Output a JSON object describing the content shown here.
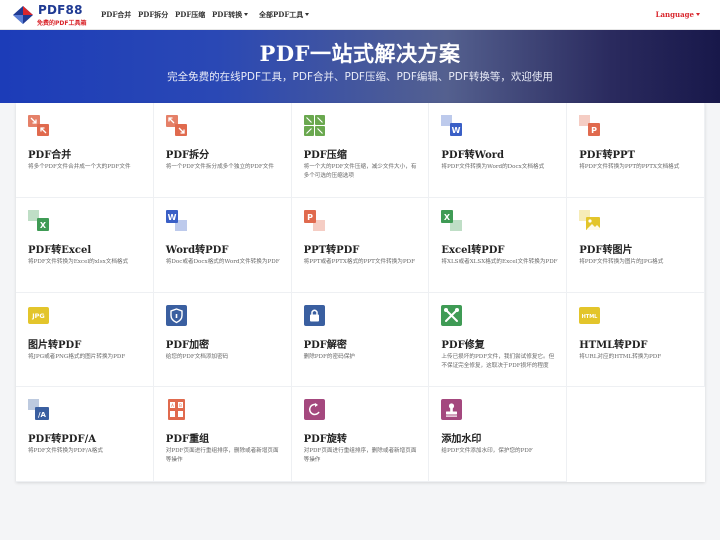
{
  "nav": {
    "logo_name": "PDF88",
    "logo_slogan": "免费的PDF工具箱",
    "items": [
      "PDF合并",
      "PDF拆分",
      "PDF压缩",
      "PDF转换",
      "全部PDF工具"
    ],
    "language": "Language"
  },
  "hero": {
    "title": "PDF一站式解决方案",
    "subtitle": "完全免费的在线PDF工具，PDF合并、PDF压缩、PDF编辑、PDF转换等，欢迎使用"
  },
  "colors": {
    "brand": "#1f3a93",
    "accent_red": "#d9262c"
  },
  "tools": [
    {
      "title": "PDF合并",
      "desc": "将多个PDF文件合并成一个大的PDF文件",
      "icon": "merge-icon",
      "color": "#e06a4e",
      "icon_style": "pair-arrows-in"
    },
    {
      "title": "PDF拆分",
      "desc": "将一个PDF文件拆分成多个独立的PDF文件",
      "icon": "split-icon",
      "color": "#e06a4e",
      "icon_style": "pair-arrows-out"
    },
    {
      "title": "PDF压缩",
      "desc": "将一个大的PDF文件压缩，减少文件大小，有多个可选的压缩选项",
      "icon": "compress-icon",
      "color": "#6aa84f",
      "icon_style": "compress"
    },
    {
      "title": "PDF转Word",
      "desc": "将PDF文件转换为Word的Docx文档格式",
      "icon": "pdf-to-word-icon",
      "color": "#3a5fc6",
      "icon_style": "badge",
      "letter": "W"
    },
    {
      "title": "PDF转PPT",
      "desc": "将PDF文件转换为PPT的PPTX文档格式",
      "icon": "pdf-to-ppt-icon",
      "color": "#e06a4e",
      "icon_style": "badge",
      "letter": "P"
    },
    {
      "title": "PDF转Excel",
      "desc": "将PDF文件转换为Excel的xlsx文档格式",
      "icon": "pdf-to-excel-icon",
      "color": "#3f9b55",
      "icon_style": "badge",
      "letter": "X"
    },
    {
      "title": "Word转PDF",
      "desc": "将Doc或者Docx格式的Word文件转换为PDF",
      "icon": "word-to-pdf-icon",
      "color": "#3a5fc6",
      "icon_style": "badge-left",
      "letter": "W"
    },
    {
      "title": "PPT转PDF",
      "desc": "将PPT或者PPTX格式的PPT文件转换为PDF",
      "icon": "ppt-to-pdf-icon",
      "color": "#e06a4e",
      "icon_style": "badge-left",
      "letter": "P"
    },
    {
      "title": "Excel转PDF",
      "desc": "将XLS或者XLSX格式的Excel文件转换为PDF",
      "icon": "excel-to-pdf-icon",
      "color": "#3f9b55",
      "icon_style": "badge-left",
      "letter": "X"
    },
    {
      "title": "PDF转图片",
      "desc": "将PDF文件转换为图片的JPG格式",
      "icon": "pdf-to-image-icon",
      "color": "#e3c52b",
      "icon_style": "image"
    },
    {
      "title": "图片转PDF",
      "desc": "将JPG或者PNG格式的图片转换为PDF",
      "icon": "image-to-pdf-icon",
      "color": "#e3c52b",
      "icon_style": "label",
      "letter": "JPG"
    },
    {
      "title": "PDF加密",
      "desc": "给您的PDF文档添加密码",
      "icon": "shield-icon",
      "color": "#3a5fa0",
      "icon_style": "shield"
    },
    {
      "title": "PDF解密",
      "desc": "删除PDF的密码保护",
      "icon": "lock-icon",
      "color": "#3a5fa0",
      "icon_style": "lock"
    },
    {
      "title": "PDF修复",
      "desc": "上传已损坏的PDF文件，我们尝试修复它。但不保证完全修复，这取决于PDF损坏的程度",
      "icon": "repair-icon",
      "color": "#3f9b55",
      "icon_style": "tools"
    },
    {
      "title": "HTML转PDF",
      "desc": "将URL对应的HTML转换为PDF",
      "icon": "html-to-pdf-icon",
      "color": "#e3c52b",
      "icon_style": "label",
      "letter": "HTML"
    },
    {
      "title": "PDF转PDF/A",
      "desc": "将PDF文件转换为PDF/A格式",
      "icon": "pdf-to-pdfa-icon",
      "color": "#3a5fa0",
      "icon_style": "pdfa",
      "letter": "/A"
    },
    {
      "title": "PDF重组",
      "desc": "对PDF页面进行重组排序，删除或者新增页面等操作",
      "icon": "reorder-icon",
      "color": "#e06a4e",
      "icon_style": "reorder"
    },
    {
      "title": "PDF旋转",
      "desc": "对PDF页面进行重组排序，删除或者新增页面等操作",
      "icon": "rotate-icon",
      "color": "#a4487e",
      "icon_style": "rotate"
    },
    {
      "title": "添加水印",
      "desc": "给PDF文件添加水印，保护您的PDF",
      "icon": "watermark-icon",
      "color": "#a4487e",
      "icon_style": "stamp"
    }
  ]
}
